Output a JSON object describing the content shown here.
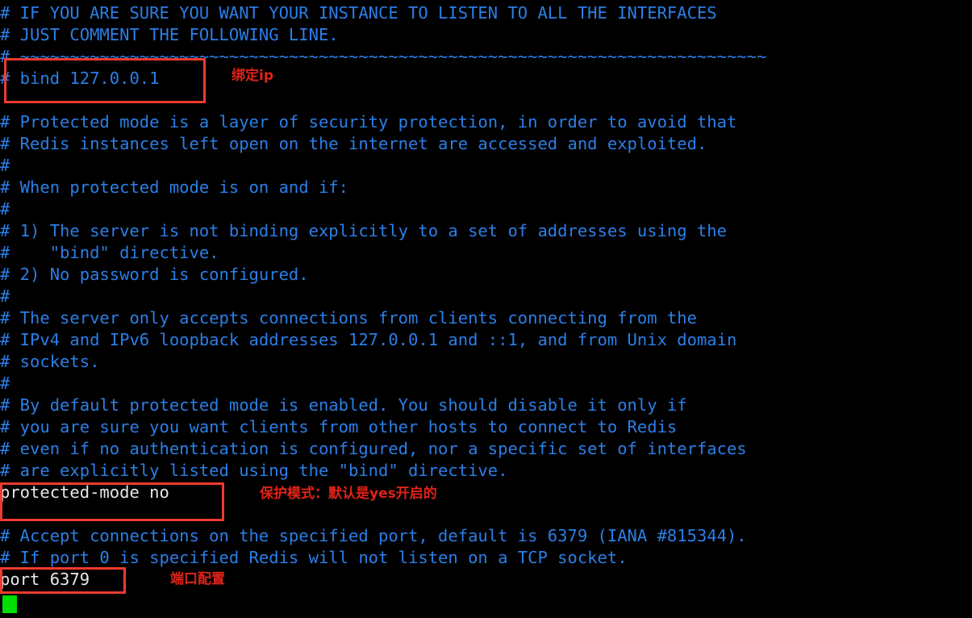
{
  "terminal": {
    "background_color": "#000000",
    "comment_color": "#2b7fe8",
    "active_color": "#e8e8e8",
    "annotation_color": "#e02318",
    "box_color": "#f03a30",
    "cursor_color": "#00dd00",
    "file": "redis.conf"
  },
  "lines": [
    {
      "text": "# IF YOU ARE SURE YOU WANT YOUR INSTANCE TO LISTEN TO ALL THE INTERFACES",
      "kind": "comment"
    },
    {
      "text": "# JUST COMMENT THE FOLLOWING LINE.",
      "kind": "comment"
    },
    {
      "text": "# ~~~~~~~~~~~~~~~~~~~~~~~~~~~~~~~~~~~~~~~~~~~~~~~~~~~~~~~~~~~~~~~~~~~~~~~~~~~",
      "kind": "comment"
    },
    {
      "text": "# bind 127.0.0.1",
      "kind": "comment"
    },
    {
      "text": "",
      "kind": "comment"
    },
    {
      "text": "# Protected mode is a layer of security protection, in order to avoid that",
      "kind": "comment"
    },
    {
      "text": "# Redis instances left open on the internet are accessed and exploited.",
      "kind": "comment"
    },
    {
      "text": "#",
      "kind": "comment"
    },
    {
      "text": "# When protected mode is on and if:",
      "kind": "comment"
    },
    {
      "text": "#",
      "kind": "comment"
    },
    {
      "text": "# 1) The server is not binding explicitly to a set of addresses using the",
      "kind": "comment"
    },
    {
      "text": "#    \"bind\" directive.",
      "kind": "comment"
    },
    {
      "text": "# 2) No password is configured.",
      "kind": "comment"
    },
    {
      "text": "#",
      "kind": "comment"
    },
    {
      "text": "# The server only accepts connections from clients connecting from the",
      "kind": "comment"
    },
    {
      "text": "# IPv4 and IPv6 loopback addresses 127.0.0.1 and ::1, and from Unix domain",
      "kind": "comment"
    },
    {
      "text": "# sockets.",
      "kind": "comment"
    },
    {
      "text": "#",
      "kind": "comment"
    },
    {
      "text": "# By default protected mode is enabled. You should disable it only if",
      "kind": "comment"
    },
    {
      "text": "# you are sure you want clients from other hosts to connect to Redis",
      "kind": "comment"
    },
    {
      "text": "# even if no authentication is configured, nor a specific set of interfaces",
      "kind": "comment"
    },
    {
      "text": "# are explicitly listed using the \"bind\" directive.",
      "kind": "comment"
    },
    {
      "text": "protected-mode no",
      "kind": "active"
    },
    {
      "text": "",
      "kind": "comment"
    },
    {
      "text": "# Accept connections on the specified port, default is 6379 (IANA #815344).",
      "kind": "comment"
    },
    {
      "text": "# If port 0 is specified Redis will not listen on a TCP socket.",
      "kind": "comment"
    },
    {
      "text": "port 6379",
      "kind": "active"
    }
  ],
  "annotations": [
    {
      "name": "bind-ip-note",
      "text": "绑定ip"
    },
    {
      "name": "protected-mode-note",
      "text": "保护模式：默认是yes开启的"
    },
    {
      "name": "port-note",
      "text": "端口配置"
    }
  ],
  "highlight_boxes": [
    {
      "name": "bind-directive-box",
      "target": "# bind 127.0.0.1"
    },
    {
      "name": "protected-mode-box",
      "target": "protected-mode no"
    },
    {
      "name": "port-box",
      "target": "port 6379"
    }
  ]
}
